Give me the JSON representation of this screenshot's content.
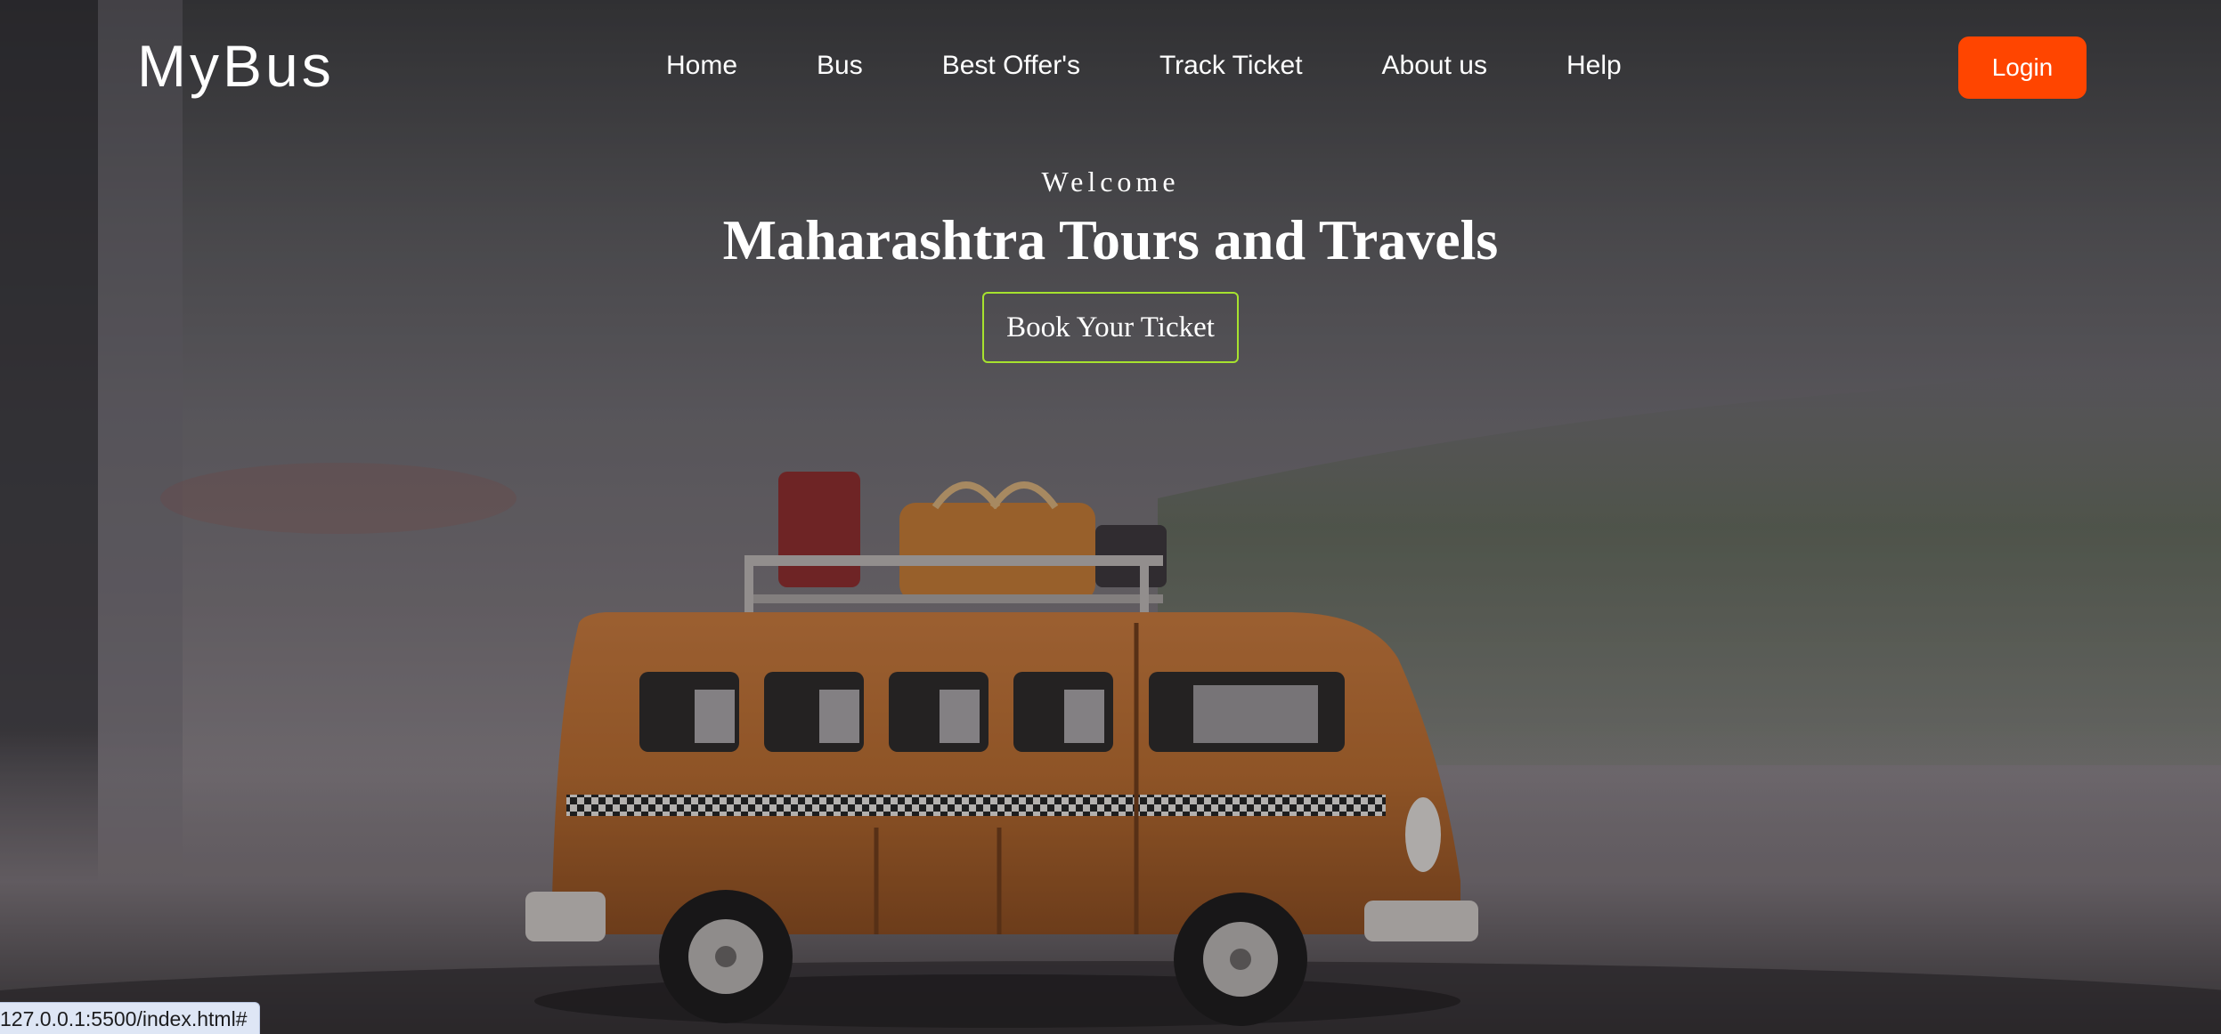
{
  "navbar": {
    "brand": "MyBus",
    "links": [
      {
        "label": "Home"
      },
      {
        "label": "Bus"
      },
      {
        "label": "Best Offer's"
      },
      {
        "label": "Track Ticket"
      },
      {
        "label": "About us"
      },
      {
        "label": "Help"
      }
    ],
    "login_label": "Login"
  },
  "hero": {
    "welcome": "Welcome",
    "title": "Maharashtra Tours and Travels",
    "cta_label": "Book Your Ticket",
    "image_subject": "toy orange bus with luggage on roof rack"
  },
  "status_bar": {
    "url": "127.0.0.1:5500/index.html#"
  },
  "colors": {
    "login_button": "#ff4500",
    "cta_border": "#a6e22e",
    "text": "#ffffff"
  }
}
